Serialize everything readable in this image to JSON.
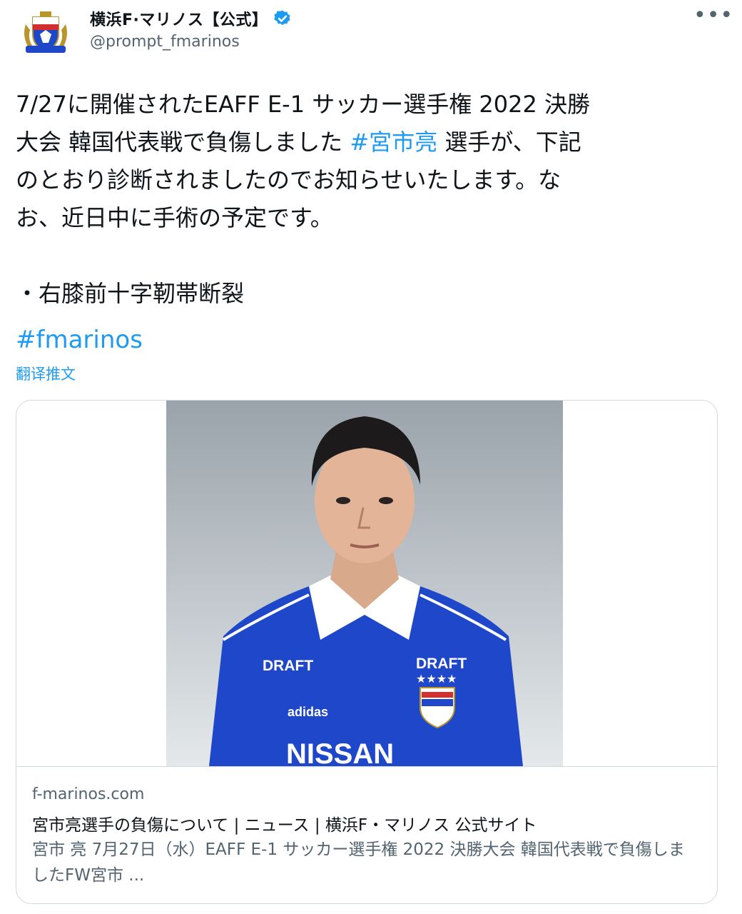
{
  "author": {
    "display_name": "横浜F·マリノス【公式】",
    "handle": "@prompt_fmarinos",
    "verified": true,
    "avatar_icon": "fmarinos-crest-icon"
  },
  "more_label": "•••",
  "tweet": {
    "line1_pre": "7/27に開催されたEAFF E-1 サッカー選手権 2022 決勝",
    "line2_pre": "大会 韓国代表戦で負傷しました ",
    "hashtag_player": "#宮市亮",
    "line2_post": " 選手が、下記",
    "line3": "のとおり診断されましたのでお知らせいたします。な",
    "line4": "お、近日中に手術の予定です。",
    "bullet": "・右膝前十字靭帯断裂",
    "hashtag_club": "#fmarinos",
    "translate_label": "翻译推文"
  },
  "card": {
    "image_icon": "player-photo-icon",
    "image_text": {
      "sponsor_left": "DRAFT",
      "sponsor_right": "DRAFT",
      "maker": "adidas",
      "chest": "NISSAN",
      "stars": "★★★★"
    },
    "domain": "f-marinos.com",
    "title": "宮市亮選手の負傷について | ニュース | 横浜F・マリノス 公式サイト",
    "description": "宮市 亮 7月27日（水）EAFF E-1 サッカー選手権 2022 決勝大会 韓国代表戦で負傷しましたFW宮市 ..."
  },
  "colors": {
    "link": "#1d9bf0",
    "secondary_text": "#536471",
    "jersey_blue": "#1f47c9",
    "crest_red": "#d32f2f"
  }
}
